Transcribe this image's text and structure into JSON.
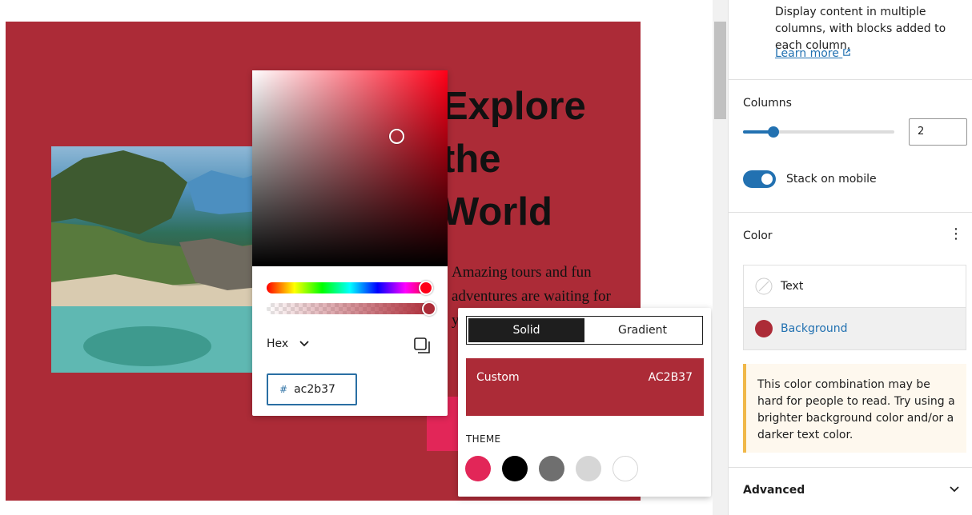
{
  "canvas": {
    "heading_lines": [
      "Explore",
      "the",
      "World"
    ],
    "paragraph": "Amazing tours and fun adventures are waiting for you."
  },
  "picker": {
    "format_label": "Hex",
    "hex_prefix": "#",
    "hex_value": "ac2b37",
    "icons": [
      "chevron-down-icon",
      "copy-icon"
    ]
  },
  "color_panel": {
    "tabs": [
      {
        "label": "Solid",
        "active": true
      },
      {
        "label": "Gradient",
        "active": false
      }
    ],
    "custom_label": "Custom",
    "custom_value": "AC2B37",
    "theme_label": "THEME",
    "theme_colors": [
      "#e22658",
      "#000000",
      "#6f6f6f",
      "#d6d6d6",
      "#ffffff"
    ]
  },
  "sidebar": {
    "description": "Display content in multiple columns, with blocks added to each column.",
    "learn_more": "Learn more",
    "columns_label": "Columns",
    "columns_value": "2",
    "stack_on_mobile_label": "Stack on mobile",
    "stack_on_mobile_enabled": true,
    "color_section_title": "Color",
    "color_items": [
      {
        "label": "Text",
        "swatch": "none"
      },
      {
        "label": "Background",
        "swatch": "#ac2b37"
      }
    ],
    "notice": "This color combination may be hard for people to read. Try using a brighter background color and/or a darker text color.",
    "advanced_label": "Advanced"
  },
  "colors": {
    "background": "#ac2b37",
    "accent_blue": "#2271b1",
    "button_pink": "#e22658"
  }
}
